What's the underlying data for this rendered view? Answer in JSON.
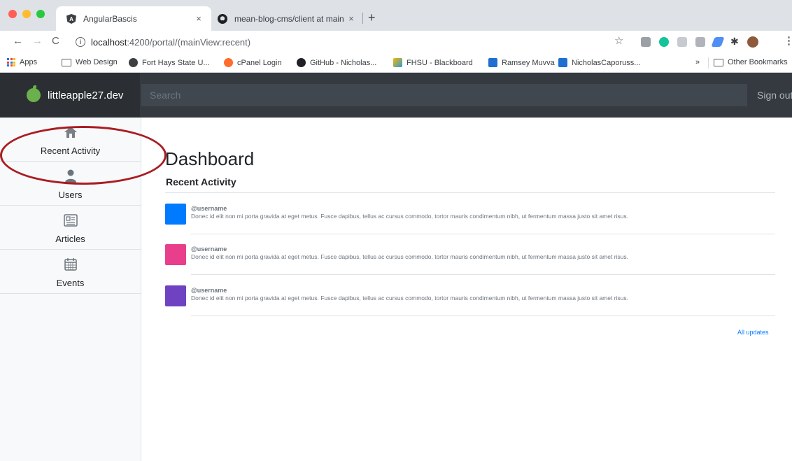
{
  "browser": {
    "tabs": [
      {
        "title": "AngularBascis",
        "close": "×"
      },
      {
        "title": "mean-blog-cms/client at main",
        "close": "×"
      }
    ],
    "new_tab": "+",
    "nav": {
      "back": "←",
      "forward": "→",
      "reload": "C"
    },
    "url": {
      "host": "localhost",
      "path": ":4200/portal/(mainView:recent)"
    },
    "bookmarks": [
      {
        "label": "Apps"
      },
      {
        "label": "Web Design"
      },
      {
        "label": "Fort Hays State U..."
      },
      {
        "label": "cPanel Login"
      },
      {
        "label": "GitHub - Nicholas..."
      },
      {
        "label": "FHSU - Blackboard"
      },
      {
        "label": "Ramsey Muvva"
      },
      {
        "label": "NicholasCaporuss..."
      }
    ],
    "bookmarks_more": "»",
    "other_bookmarks": "Other Bookmarks"
  },
  "navbar": {
    "brand": "littleapple27.dev",
    "search_placeholder": "Search",
    "signout": "Sign out"
  },
  "sidebar": {
    "items": [
      {
        "label": "Recent Activity",
        "icon": "home-icon"
      },
      {
        "label": "Users",
        "icon": "user-icon"
      },
      {
        "label": "Articles",
        "icon": "newspaper-icon"
      },
      {
        "label": "Events",
        "icon": "calendar-icon"
      }
    ]
  },
  "main": {
    "title": "Dashboard",
    "subtitle": "Recent Activity",
    "activities": [
      {
        "user": "@username",
        "text": "Donec id elit non mi porta gravida at eget metus. Fusce dapibus, tellus ac cursus commodo, tortor mauris condimentum nibh, ut fermentum massa justo sit amet risus.",
        "color": "#007bff"
      },
      {
        "user": "@username",
        "text": "Donec id elit non mi porta gravida at eget metus. Fusce dapibus, tellus ac cursus commodo, tortor mauris condimentum nibh, ut fermentum massa justo sit amet risus.",
        "color": "#e83e8c"
      },
      {
        "user": "@username",
        "text": "Donec id elit non mi porta gravida at eget metus. Fusce dapibus, tellus ac cursus commodo, tortor mauris condimentum nibh, ut fermentum massa justo sit amet risus.",
        "color": "#6f42c1"
      }
    ],
    "all_updates": "All updates"
  },
  "colors": {
    "navbar_bg": "#343a40",
    "brand_bg": "#2b2f33",
    "link": "#007bff",
    "annotation_circle": "#a91d22"
  }
}
